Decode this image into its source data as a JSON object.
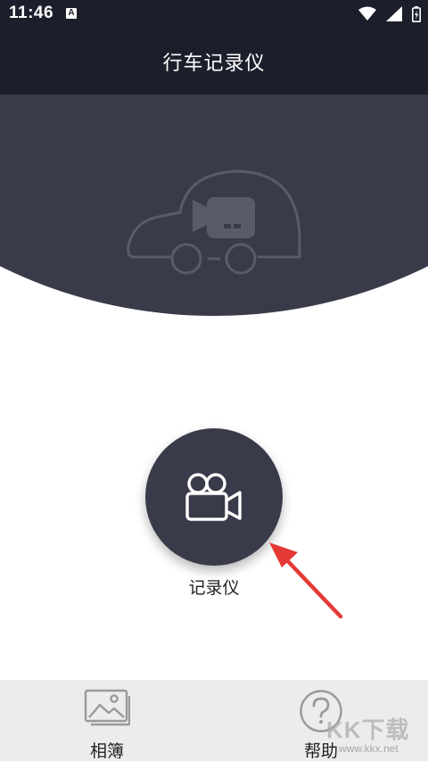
{
  "status_bar": {
    "time": "11:46",
    "notification_badge": "A",
    "icons": [
      "wifi-icon",
      "signal-icon",
      "battery-icon"
    ]
  },
  "header": {
    "title": "行车记录仪"
  },
  "hero": {
    "illustration": "car-with-camera-icon"
  },
  "main": {
    "record_button_icon": "video-camera-icon",
    "record_label": "记录仪"
  },
  "bottom_nav": {
    "items": [
      {
        "label": "相簿",
        "icon": "image-icon"
      },
      {
        "label": "帮助",
        "icon": "question-icon"
      }
    ]
  },
  "watermark": {
    "text": "KK下载",
    "url": "www.kkx.net"
  },
  "colors": {
    "header_bg": "#1c1f2b",
    "hero_bg": "#3a3b4a",
    "button_bg": "#3a3b4a",
    "nav_bg": "#ececec",
    "arrow": "#e53935"
  }
}
